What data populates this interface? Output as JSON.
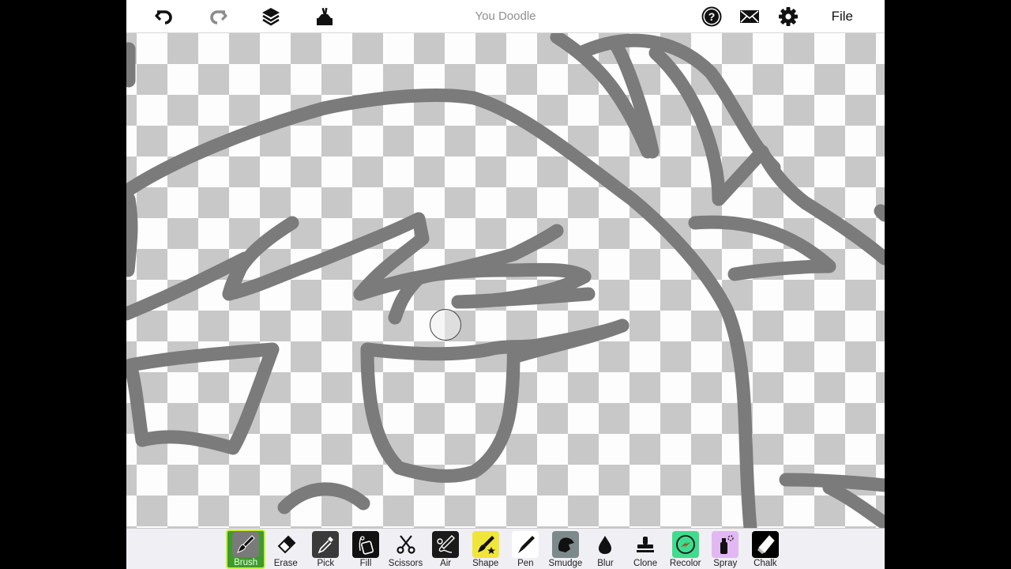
{
  "app": {
    "title": "You Doodle",
    "file_label": "File"
  },
  "top_toolbar": {
    "left": [
      {
        "name": "undo",
        "icon": "undo-icon",
        "enabled": true
      },
      {
        "name": "redo",
        "icon": "redo-icon",
        "enabled": false
      },
      {
        "name": "layers",
        "icon": "layers-icon",
        "enabled": true
      },
      {
        "name": "stamp-tools",
        "icon": "toolbox-icon",
        "enabled": true
      }
    ],
    "right": [
      {
        "name": "help",
        "icon": "help-icon"
      },
      {
        "name": "message",
        "icon": "mail-icon"
      },
      {
        "name": "settings",
        "icon": "gear-icon"
      }
    ]
  },
  "tools": [
    {
      "id": "brush",
      "label": "Brush",
      "active": true,
      "bg": "#7a7a7a"
    },
    {
      "id": "erase",
      "label": "Erase",
      "active": false,
      "bg": "transparent"
    },
    {
      "id": "pick",
      "label": "Pick",
      "active": false,
      "bg": "#3a3a3a"
    },
    {
      "id": "fill",
      "label": "Fill",
      "active": false,
      "bg": "#111111"
    },
    {
      "id": "scissors",
      "label": "Scissors",
      "active": false,
      "bg": "transparent"
    },
    {
      "id": "air",
      "label": "Air",
      "active": false,
      "bg": "#1a1a1a"
    },
    {
      "id": "shape",
      "label": "Shape",
      "active": false,
      "bg": "#f0e63a"
    },
    {
      "id": "pen",
      "label": "Pen",
      "active": false,
      "bg": "#ffffff"
    },
    {
      "id": "smudge",
      "label": "Smudge",
      "active": false,
      "bg": "#7d8a8c"
    },
    {
      "id": "blur",
      "label": "Blur",
      "active": false,
      "bg": "transparent"
    },
    {
      "id": "clone",
      "label": "Clone",
      "active": false,
      "bg": "transparent"
    },
    {
      "id": "recolor",
      "label": "Recolor",
      "active": false,
      "bg": "#3fdc8e"
    },
    {
      "id": "spray",
      "label": "Spray",
      "active": false,
      "bg": "#e2b8f2"
    },
    {
      "id": "chalk",
      "label": "Chalk",
      "active": false,
      "bg": "#000000"
    }
  ],
  "colors": {
    "stroke": "#7b7b7b",
    "checker_dark": "#c8c8c8",
    "checker_light": "#fdfdfd",
    "active_tool": "#3f9a2e",
    "toolbar_bg": "#efeff4"
  }
}
